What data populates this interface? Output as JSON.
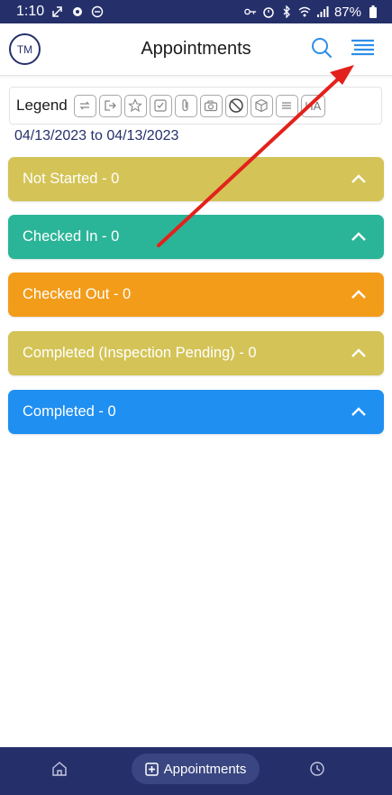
{
  "status_bar": {
    "time": "1:10",
    "battery": "87%"
  },
  "header": {
    "avatar_initials": "TM",
    "title": "Appointments",
    "search_icon": "search-icon",
    "menu_icon": "menu-icon"
  },
  "legend": {
    "label": "Legend",
    "icons": [
      "repeat-icon",
      "exit-icon",
      "star-icon",
      "checkbox-icon",
      "paperclip-icon",
      "camera-icon",
      "ban-icon",
      "cube-icon",
      "lines-icon"
    ],
    "ha_label": "HA"
  },
  "date_range": "04/13/2023 to 04/13/2023",
  "sections": [
    {
      "label": "Not Started - 0",
      "color": "#d4c356"
    },
    {
      "label": "Checked In - 0",
      "color": "#2bb598"
    },
    {
      "label": "Checked Out - 0",
      "color": "#f29c1a"
    },
    {
      "label": "Completed (Inspection Pending) - 0",
      "color": "#d4c356"
    },
    {
      "label": "Completed - 0",
      "color": "#1f8ff2"
    }
  ],
  "bottom_nav": {
    "appointments_label": "Appointments"
  },
  "colors": {
    "brand": "#25306b",
    "annotation_arrow": "#e3211c"
  }
}
